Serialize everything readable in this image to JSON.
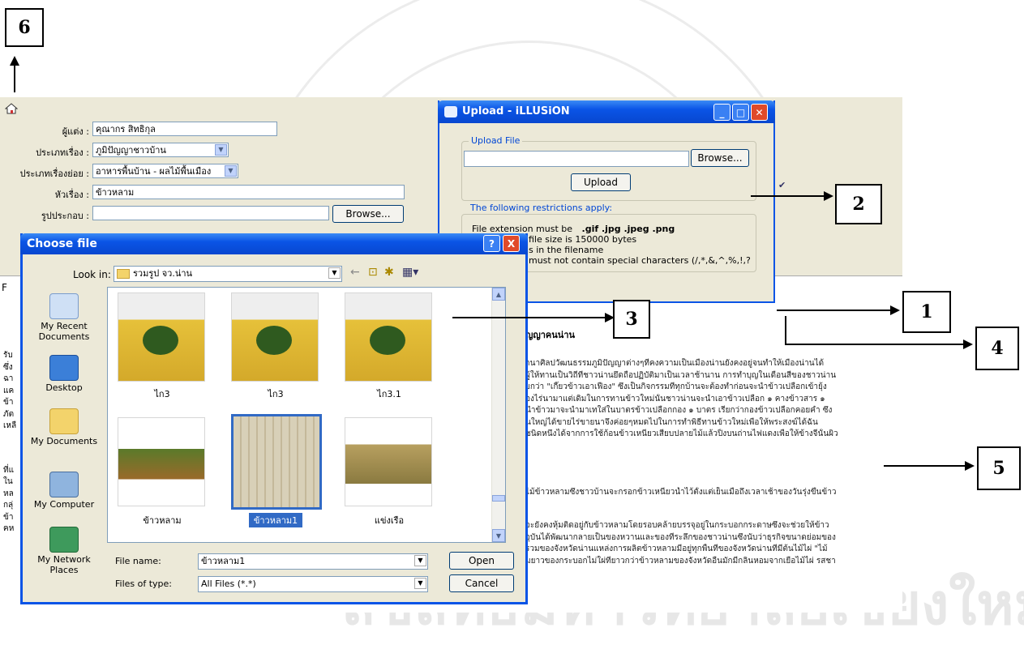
{
  "callouts": [
    "1",
    "2",
    "3",
    "4",
    "5",
    "6"
  ],
  "editor": {
    "fields": [
      {
        "label": "ผู้แต่ง :",
        "value": "คุณากร สิทธิกุล"
      },
      {
        "label": "ประเภทเรื่อง :",
        "value": "ภูมิปัญญาชาวบ้าน"
      },
      {
        "label": "ประเภทเรื่องย่อย :",
        "value": "อาหารพื้นบ้าน - ผลไม้พื้นเมือง"
      },
      {
        "label": "หัวเรื่อง :",
        "value": "ข้าวหลาม"
      },
      {
        "label": "รูปประกอบ :",
        "value": ""
      }
    ],
    "browse_label": "Browse...",
    "content_heading": "ญญาคนน่าน",
    "content_lines_a": [
      "านาศิลปวัฒนธรรมภูมิปัญญาต่างๆที่คงความเป็นเมืองน่านยังคงอยู่จนทำให้เมืองน่านได้",
      "ผู้ให้ทานเป็นวิถีที่ชาวน่านยึดถือปฏิบัติมาเป็นเวลาช้านาน การทำบุญในเดือนสี่ของชาวน่าน",
      "ยกว่า \"เกี๊ยวข้าวเอาเฟือง\" ซึ่งเป็นกิจกรรมที่ทุกบ้านจะต้องทำก่อนจะนำข้าวเปลือกเข้ายุ้ง",
      "องไร่นามาแต่เดิมในการทานข้าวใหม่นั้นชาวน่านจะนำเอาข้าวเปลือก ๑ คางข้าวสาร ๑",
      "นำข้าวมาจะนำมาเทใส่ในบาตรข้าวเปลือกกอง ๑ บาตร เรียกว่ากองข้าวเปลือกคอยคำ ซึ่ง",
      "นใหญ่ได้ขายไร่ขายนาจึงค่อยๆหมดไปในการทำพิธีทานข้าวใหม่เพื่อให้พระสงฆ์ได้ฉัน",
      "ชนิดหนึ่งได้จากการใช้ก้อนข้าวเหนียวเสียบปลายไม้แล้วปิ้งบนถ่านไฟแดงเพื่อให้ข้างจี่นั้นผิว"
    ],
    "content_line_b": "ไม้ข้าวหลามซึ่งชาวบ้านจะกรอกข้าวเหนียวน้ำไว้ตั้งแต่เย็นเมื่อถึงเวลาเช้าของวันรุ่งขึ้นข้าว",
    "content_lines_c": [
      "จะยังคงหุ้มติดอยู่กับข้าวหลามโดยรอบคล้ายบรรจุอยู่ในกระบอกกระดาษซึ่งจะช่วยให้ข้าว",
      "จุบันได้พัฒนากลายเป็นของหวานและของที่ระลึกของชาวน่านซึ่งนับว่าธุรกิจขนาดย่อมของ",
      "รวมของจังหวัดน่านแหล่งการผลิตข้าวหลามมีอยู่ทุกพื้นที่ของจังหวัดน่านที่มีต้นไม้ไผ่ \"ไม้",
      "มยาวของกระบอกไม่ใผ่ที่ยาวกว่าข้าวหลามของจังหวัดอื่นมักมีกลิ่นหอมจากเยื่อไม้ไผ่ รสชา"
    ],
    "left_fragments": [
      "รับ",
      "ซึ่ง",
      "ฉา",
      "แค",
      "ข้า",
      "ภัต",
      "เหลื",
      "ที่แ",
      "ใน",
      "หล",
      "กลุ่",
      "ข้า",
      "ฅห"
    ],
    "tab_fragment": "F"
  },
  "upload": {
    "title": "Upload - iLLUSiON",
    "group_label": "Upload File",
    "browse_label": "Browse...",
    "upload_button": "Upload",
    "restrictions_heading": "The following restrictions apply:",
    "restriction_1_prefix": "File exten",
    "restriction_1_tail": "sion must be",
    "extensions": ".gif  .jpg  .jpeg  .png",
    "restriction_2": "file size is 150000 bytes",
    "restriction_3": "s in the filename",
    "restriction_4": "must not contain special characters (/,*,&,^,%,!,?"
  },
  "choose": {
    "title": "Choose file",
    "look_in_label": "Look in:",
    "look_in_value": "รวมรูป จว.น่าน",
    "places": [
      "My Recent Documents",
      "Desktop",
      "My Documents",
      "My Computer",
      "My Network Places"
    ],
    "files": [
      "ไก3",
      "ไก3",
      "ไก3.1",
      "ข้าวหลาม",
      "ข้าวหลาม1",
      "แข่งเรือ"
    ],
    "file_name_label": "File name:",
    "file_name_value": "ข้าวหลาม1",
    "files_of_type_label": "Files of type:",
    "files_of_type_value": "All Files (*.*)",
    "open_button": "Open",
    "cancel_button": "Cancel",
    "help_button": "?",
    "close_button": "X"
  }
}
